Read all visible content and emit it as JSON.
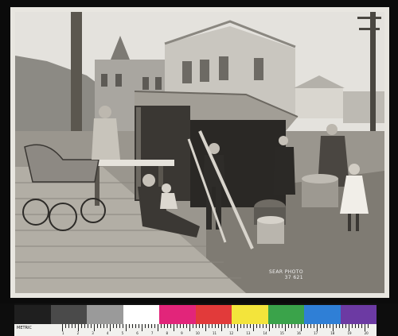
{
  "photo": {
    "caption_line1": "SEAR PHOTO",
    "caption_line2": "37  621"
  },
  "color_target": {
    "swatches": [
      "#1f1f1f",
      "#4a4a4a",
      "#9a9a9a",
      "#ffffff",
      "#e2257a",
      "#e23a3a",
      "#f3e43b",
      "#3aa34a",
      "#2f7fd6",
      "#6c3aa3"
    ],
    "ruler_label": "METRIC",
    "ruler_numbers": [
      "1",
      "2",
      "3",
      "4",
      "5",
      "6",
      "7",
      "8",
      "9",
      "10",
      "11",
      "12",
      "13",
      "14",
      "15",
      "16",
      "17",
      "18",
      "19",
      "20"
    ]
  }
}
